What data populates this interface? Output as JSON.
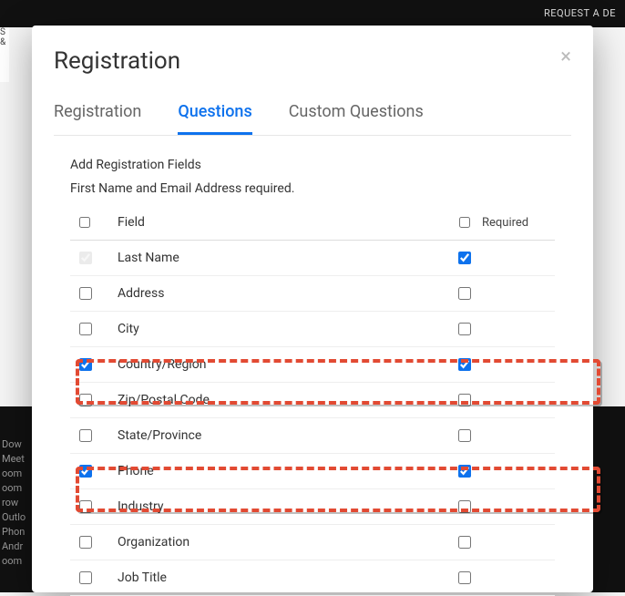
{
  "background": {
    "topbar_text": "REQUEST A DE",
    "left_fragment": "S &",
    "bottom_lines": [
      "Dow",
      "Meet",
      "oom",
      "oom",
      "row",
      "Outlo",
      "Phon",
      "Andr",
      "oom"
    ]
  },
  "modal": {
    "title": "Registration",
    "close_label": "×",
    "tabs": {
      "registration": "Registration",
      "questions": "Questions",
      "custom": "Custom Questions"
    },
    "intro_line1": "Add Registration Fields",
    "intro_line2": "First Name and Email Address required.",
    "header": {
      "field": "Field",
      "required": "Required"
    },
    "rows": [
      {
        "label": "Last Name",
        "enabled": true,
        "disabled_checkbox": true,
        "required": true
      },
      {
        "label": "Address",
        "enabled": false,
        "disabled_checkbox": false,
        "required": false
      },
      {
        "label": "City",
        "enabled": false,
        "disabled_checkbox": false,
        "required": false
      },
      {
        "label": "Country/Region",
        "enabled": true,
        "disabled_checkbox": false,
        "required": true
      },
      {
        "label": "Zip/Postal Code",
        "enabled": false,
        "disabled_checkbox": false,
        "required": false
      },
      {
        "label": "State/Province",
        "enabled": false,
        "disabled_checkbox": false,
        "required": false
      },
      {
        "label": "Phone",
        "enabled": true,
        "disabled_checkbox": false,
        "required": true
      },
      {
        "label": "Industry",
        "enabled": false,
        "disabled_checkbox": false,
        "required": false
      },
      {
        "label": "Organization",
        "enabled": false,
        "disabled_checkbox": false,
        "required": false
      },
      {
        "label": "Job Title",
        "enabled": false,
        "disabled_checkbox": false,
        "required": false
      }
    ]
  }
}
